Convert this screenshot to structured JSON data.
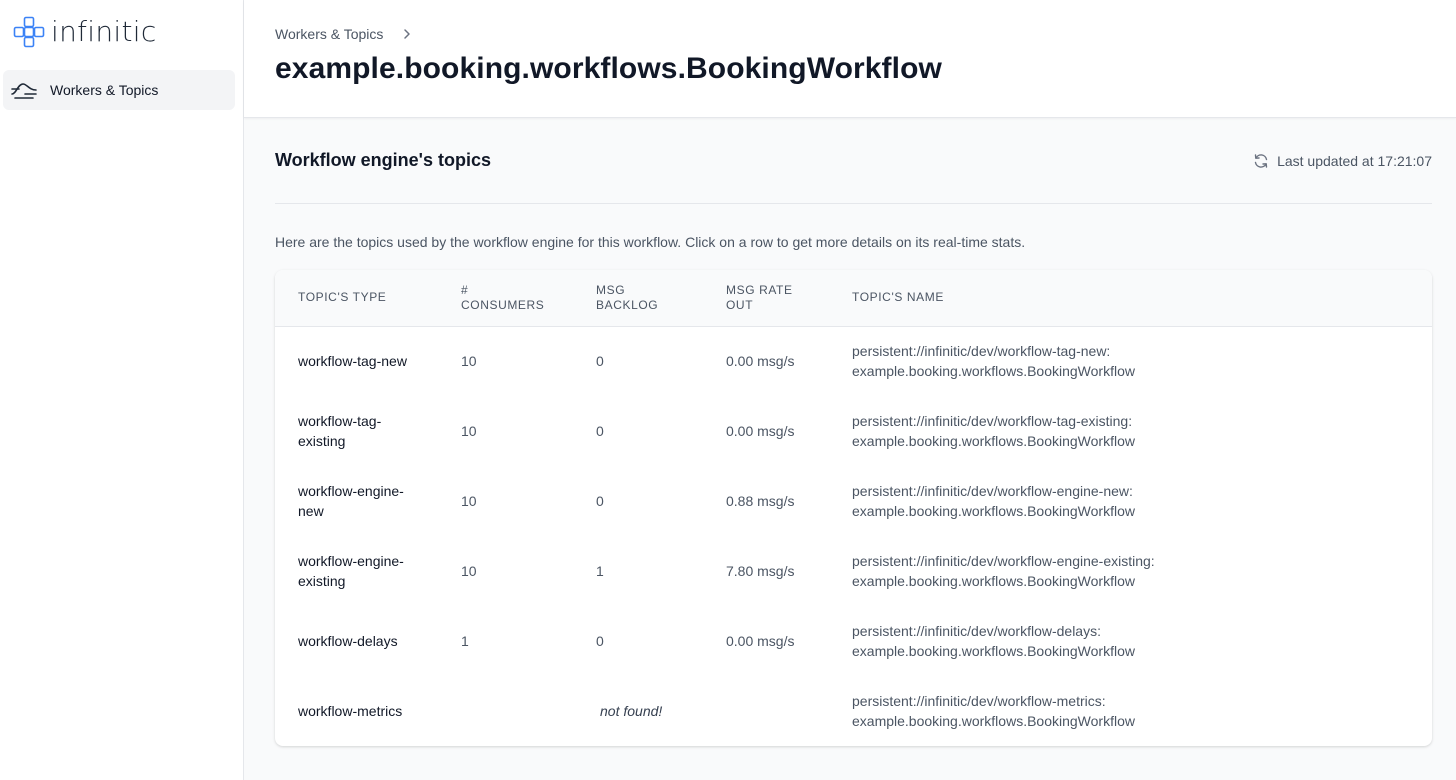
{
  "app": {
    "logo_text": "infinitic"
  },
  "sidebar": {
    "items": [
      {
        "label": "Workers & Topics",
        "icon": "workers-topics-icon"
      }
    ]
  },
  "header": {
    "breadcrumb": "Workers & Topics",
    "title": "example.booking.workflows.BookingWorkflow"
  },
  "section": {
    "title": "Workflow engine's topics",
    "last_updated": "Last updated at 17:21:07",
    "description": "Here are the topics used by the workflow engine for this workflow. Click on a row to get more details on its real-time stats."
  },
  "table": {
    "columns": [
      {
        "line1": "Topic's type",
        "line2": ""
      },
      {
        "line1": "#",
        "line2": "Consumers"
      },
      {
        "line1": "Msg",
        "line2": "backlog"
      },
      {
        "line1": "Msg rate",
        "line2": "out"
      },
      {
        "line1": "Topic's name",
        "line2": ""
      }
    ],
    "rows": [
      {
        "type": "workflow-tag-new",
        "consumers": "10",
        "backlog": "0",
        "rate": "0.00 msg/s",
        "name_line1": "persistent://infinitic/dev/workflow-tag-new:",
        "name_line2": "example.booking.workflows.BookingWorkflow"
      },
      {
        "type": "workflow-tag-existing",
        "consumers": "10",
        "backlog": "0",
        "rate": "0.00 msg/s",
        "name_line1": "persistent://infinitic/dev/workflow-tag-existing:",
        "name_line2": "example.booking.workflows.BookingWorkflow"
      },
      {
        "type": "workflow-engine-new",
        "consumers": "10",
        "backlog": "0",
        "rate": "0.88 msg/s",
        "name_line1": "persistent://infinitic/dev/workflow-engine-new:",
        "name_line2": "example.booking.workflows.BookingWorkflow"
      },
      {
        "type": "workflow-engine-existing",
        "consumers": "10",
        "backlog": "1",
        "rate": "7.80 msg/s",
        "name_line1": "persistent://infinitic/dev/workflow-engine-existing:",
        "name_line2": "example.booking.workflows.BookingWorkflow"
      },
      {
        "type": "workflow-delays",
        "consumers": "1",
        "backlog": "0",
        "rate": "0.00 msg/s",
        "name_line1": "persistent://infinitic/dev/workflow-delays:",
        "name_line2": "example.booking.workflows.BookingWorkflow"
      },
      {
        "type": "workflow-metrics",
        "not_found": "not found!",
        "name_line1": "persistent://infinitic/dev/workflow-metrics:",
        "name_line2": "example.booking.workflows.BookingWorkflow"
      }
    ]
  },
  "colors": {
    "brand": "#3b82f6",
    "text": "#111827",
    "muted": "#4b5563",
    "border": "#e5e7eb",
    "background": "#f9fafb"
  }
}
